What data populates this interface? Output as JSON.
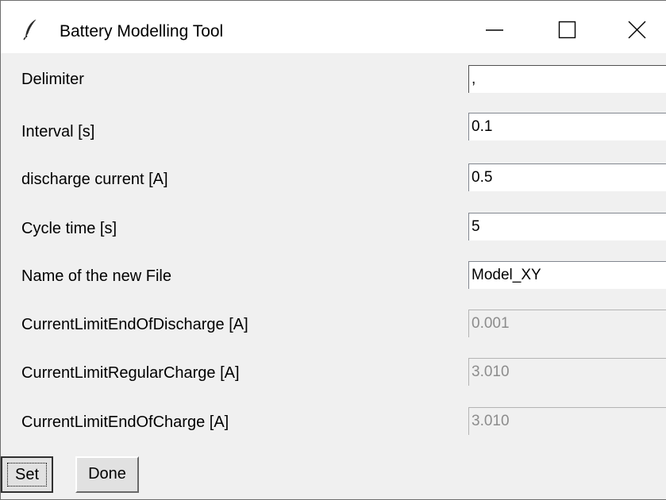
{
  "window": {
    "title": "Battery Modelling Tool",
    "icon": "feather-icon",
    "controls": [
      "minimize-icon",
      "maximize-icon",
      "close-icon"
    ]
  },
  "fields": [
    {
      "label": "Delimiter",
      "value": ",",
      "state": "normal"
    },
    {
      "label": "Interval [s]",
      "value": "0.1",
      "state": "normal"
    },
    {
      "label": "discharge current [A]",
      "value": "0.5",
      "state": "normal"
    },
    {
      "label": "Cycle time [s]",
      "value": "5",
      "state": "normal"
    },
    {
      "label": "Name of the new File",
      "value": "Model_XY",
      "state": "normal"
    },
    {
      "label": "CurrentLimitEndOfDischarge [A]",
      "value": "0.001",
      "state": "disabled"
    },
    {
      "label": "CurrentLimitRegularCharge [A]",
      "value": "3.010",
      "state": "disabled"
    },
    {
      "label": "CurrentLimitEndOfCharge [A]",
      "value": "3.010",
      "state": "disabled"
    }
  ],
  "buttons": {
    "set_label": "Set",
    "done_label": "Done"
  }
}
